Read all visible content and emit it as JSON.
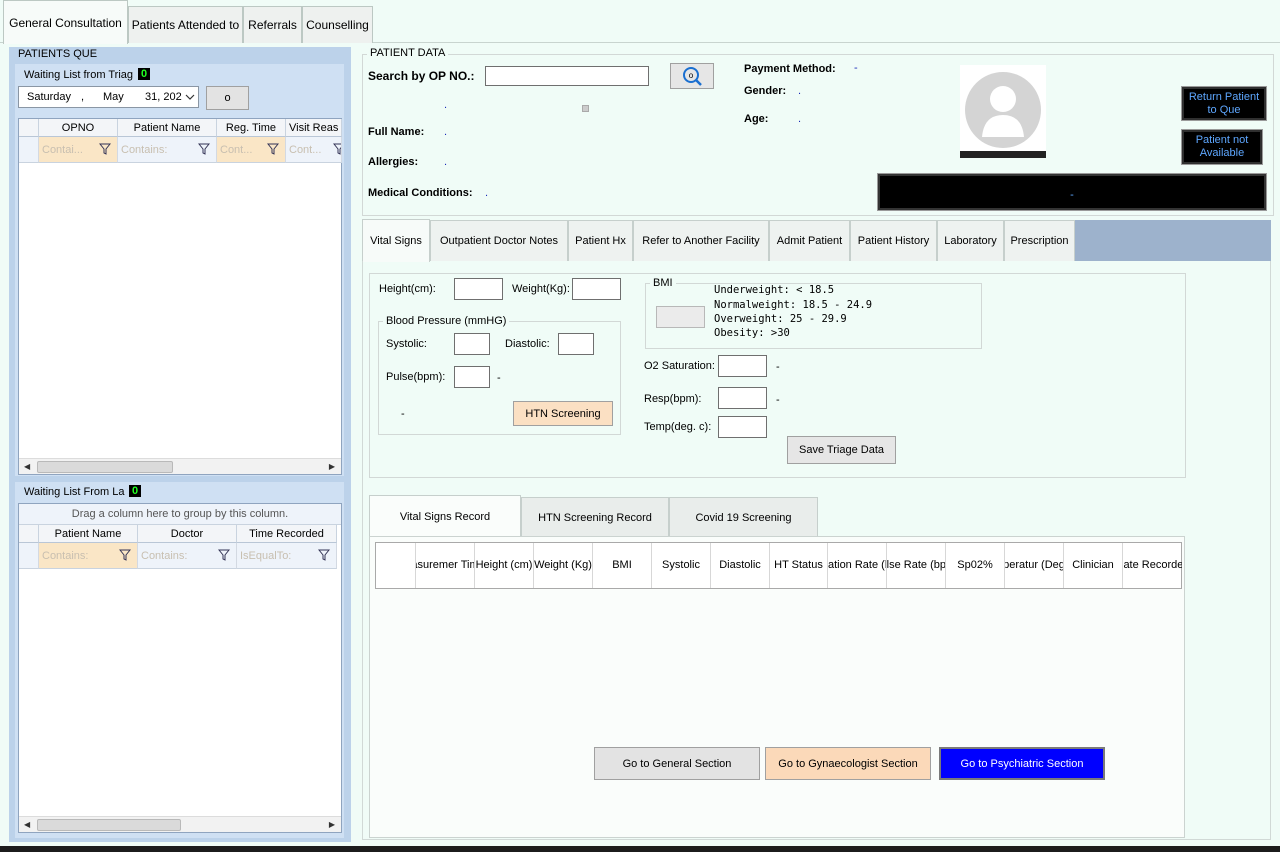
{
  "top_tabs": [
    {
      "label": "General Consultation",
      "active": true
    },
    {
      "label": "Patients Attended to"
    },
    {
      "label": "Referrals"
    },
    {
      "label": "Counselling"
    }
  ],
  "left": {
    "title": "PATIENTS QUE",
    "triage": {
      "label": "Waiting List from Triag",
      "count": "0",
      "date": {
        "day": "Saturday",
        "sep": ",",
        "month": "May",
        "daynum": "31, 202"
      },
      "go_label": "o",
      "columns": [
        "OPNO",
        "Patient Name",
        "Reg. Time",
        "Visit Reas"
      ],
      "filters": [
        "Contai...",
        "Contains:",
        "Cont...",
        "Cont..."
      ]
    },
    "lab": {
      "label": "Waiting List From La",
      "count": "0",
      "group_hint": "Drag a column here to group by this column.",
      "columns": [
        "Patient Name",
        "Doctor",
        "Time Recorded"
      ],
      "filters": [
        "Contains:",
        "Contains:",
        "IsEqualTo:"
      ]
    }
  },
  "patient": {
    "section_title": "PATIENT DATA",
    "search_label": "Search by OP NO.:",
    "search_value": "",
    "search_button": "o",
    "full_name_label": "Full Name:",
    "allergies_label": "Allergies:",
    "medical_label": "Medical Conditions:",
    "payment_label": "Payment Method:",
    "gender_label": "Gender:",
    "age_label": "Age:",
    "dash": "-",
    "dot": ".",
    "return_button": "Return Patient to Que",
    "not_available_button": "Patient not Available"
  },
  "inner_tabs": [
    {
      "label": "Vital Signs",
      "active": true
    },
    {
      "label": "Outpatient Doctor Notes"
    },
    {
      "label": "Patient Hx"
    },
    {
      "label": "Refer to Another Facility"
    },
    {
      "label": "Admit Patient"
    },
    {
      "label": "Patient History"
    },
    {
      "label": "Laboratory"
    },
    {
      "label": "Prescription"
    }
  ],
  "vitals": {
    "height_label": "Height(cm):",
    "weight_label": "Weight(Kg):",
    "bp_title": "Blood Pressure (mmHG)",
    "systolic_label": "Systolic:",
    "diastolic_label": "Diastolic:",
    "pulse_label": "Pulse(bpm):",
    "htn_button": "HTN Screening",
    "bmi_title": "BMI",
    "bmi_ranges": [
      "Underweight: < 18.5",
      "Normalweight: 18.5 - 24.9",
      "Overweight: 25 - 29.9",
      "Obesity: >30"
    ],
    "o2_label": "O2 Saturation:",
    "resp_label": "Resp(bpm):",
    "temp_label": "Temp(deg. c):",
    "save_button": "Save Triage Data",
    "dash": "-"
  },
  "record_tabs": [
    {
      "label": "Vital Signs Record",
      "active": true
    },
    {
      "label": "HTN Screening Record"
    },
    {
      "label": "Covid 19 Screening"
    }
  ],
  "record_columns": [
    "easuremer Time",
    "Height (cm)",
    "Weight (Kg)",
    "BMI",
    "Systolic",
    "Diastolic",
    "HT Status",
    "espiration Rate (bpm)",
    "Pulse Rate (bpm)",
    "Sp02%",
    "emperatur (Deg. c)",
    "Clinician",
    "Date Recorded"
  ],
  "sections": {
    "general": "Go to General Section",
    "gynae": "Go to Gynaecologist Section",
    "psych": "Go to Psychiatric Section"
  }
}
